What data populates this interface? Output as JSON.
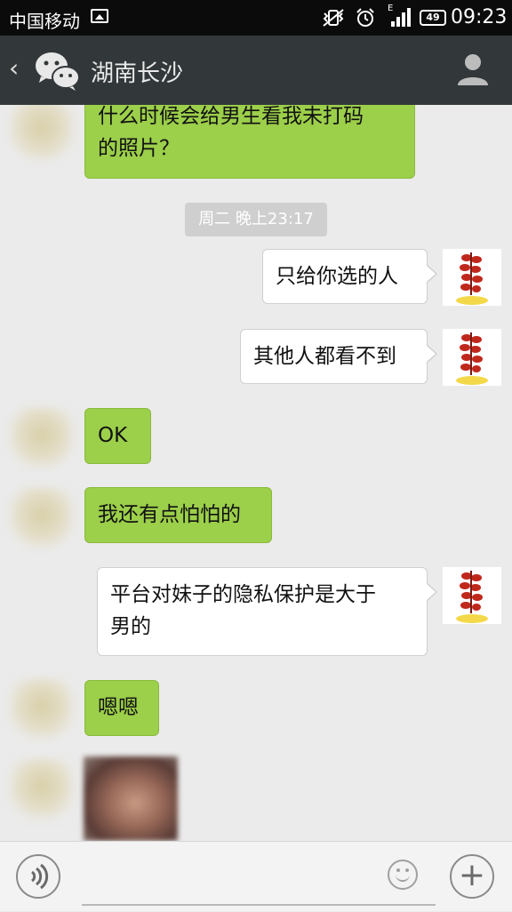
{
  "status_bar": {
    "carrier": "中国移动",
    "network_badge": "E",
    "battery": "49",
    "time": "09:23",
    "icons": [
      "gallery-icon",
      "vibrate-off-icon",
      "alarm-icon",
      "signal-icon",
      "battery-icon"
    ]
  },
  "header": {
    "back_icon": "back-chevron-icon",
    "logo_icon": "wechat-logo-icon",
    "title": "湖南长沙",
    "profile_icon": "profile-icon"
  },
  "messages": [
    {
      "side": "in",
      "text_line1": "什么时候会给男生看我未打码",
      "text_line2": "的照片？"
    },
    {
      "side": "out",
      "text": "只给你选的人"
    },
    {
      "side": "out",
      "text": "其他人都看不到"
    },
    {
      "side": "in",
      "text": "OK"
    },
    {
      "side": "in",
      "text": "我还有点怕怕的"
    },
    {
      "side": "out",
      "text_line1": "平台对妹子的隐私保护是大于",
      "text_line2": "男的"
    },
    {
      "side": "in",
      "text": "嗯嗯"
    },
    {
      "side": "in",
      "type": "photo"
    }
  ],
  "timestamp": "周二 晚上23:17",
  "input_bar": {
    "voice_icon": "voice-icon",
    "emoji_icon": "emoji-icon",
    "plus_icon": "plus-icon",
    "plus_glyph": "+",
    "voice_glyph": "◖))"
  },
  "colors": {
    "incoming_bubble": "#9ccf4a",
    "outgoing_bubble": "#ffffff",
    "title_bar": "#32383a",
    "status_bar": "#0b0b0b",
    "chat_background": "#ebebeb"
  }
}
